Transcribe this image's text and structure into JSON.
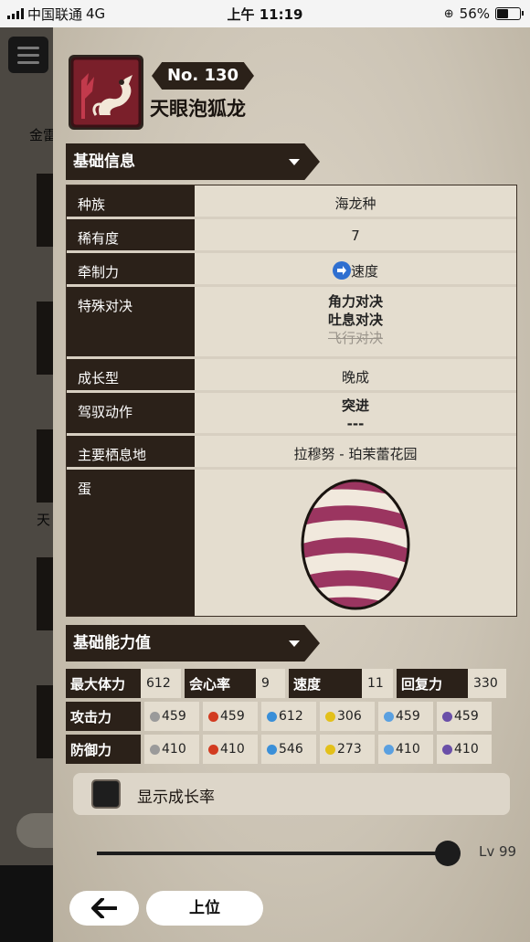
{
  "status_bar": {
    "carrier": "中国联通",
    "network": "4G",
    "time": "上午 11:19",
    "battery_percent": "56%",
    "battery_level": 0.56
  },
  "background": {
    "label_partial": "金雷",
    "label_partial_2": "天"
  },
  "monster": {
    "number": "No. 130",
    "name": "天眼泡狐龙"
  },
  "basic_info": {
    "header": "基础信息",
    "rows": {
      "species_key": "种族",
      "species_val": "海龙种",
      "rarity_key": "稀有度",
      "rarity_val": "7",
      "kinship_key": "牵制力",
      "kinship_val": "速度",
      "special_key": "特殊对决",
      "special_val_1": "角力对决",
      "special_val_2": "吐息对决",
      "special_val_3": "飞行对决",
      "growth_key": "成长型",
      "growth_val": "晚成",
      "ride_key": "驾驭动作",
      "ride_val_1": "突进",
      "ride_val_2": "---",
      "habitat_key": "主要栖息地",
      "habitat_val": "拉穆努 - 珀茉蕾花园",
      "egg_key": "蛋"
    }
  },
  "base_stats": {
    "header": "基础能力值",
    "hp_label": "最大体力",
    "hp": "612",
    "crit_label": "会心率",
    "crit": "9",
    "speed_label": "速度",
    "speed": "11",
    "recovery_label": "回复力",
    "recovery": "330",
    "attack_label": "攻击力",
    "attack": [
      "459",
      "459",
      "612",
      "306",
      "459",
      "459"
    ],
    "defense_label": "防御力",
    "defense": [
      "410",
      "410",
      "546",
      "273",
      "410",
      "410"
    ],
    "element_colors": [
      "#9a9a9a",
      "#d23b20",
      "#3a8fd8",
      "#e3c01a",
      "#5aa0e0",
      "#6a4fa8"
    ]
  },
  "growth_toggle": {
    "label": "显示成长率",
    "checked": false
  },
  "level": {
    "label": "Lv 99",
    "value": 99,
    "max": 99
  },
  "footer": {
    "rank_label": "上位"
  }
}
